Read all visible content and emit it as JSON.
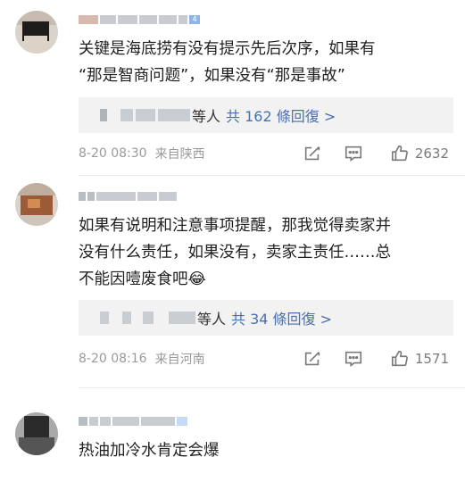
{
  "comments": [
    {
      "text": "关键是海底捞有没有提示先后次序，如果有\n“那是智商问题”，如果没有“那是事故”",
      "reply_who": "等人",
      "reply_link": "共 162 條回復 >",
      "date": "8-20 08:30",
      "location": "来自陕西",
      "likes": "2632",
      "badge": "4"
    },
    {
      "text": "如果有说明和注意事项提醒，那我觉得卖家并\n没有什么责任，如果没有，卖家主责任……总\n不能因噎废食吧😂",
      "reply_who": "等人",
      "reply_link": "共 34 條回復 >",
      "date": "8-20 08:16",
      "location": "来自河南",
      "likes": "1571"
    },
    {
      "text": "热油加冷水肯定会爆"
    }
  ],
  "colors": {
    "link": "#4a6fae",
    "meta": "#9a9a9a",
    "reply_bg": "#f2f2f2"
  },
  "icons": [
    "share-icon",
    "comment-icon",
    "like-icon"
  ]
}
